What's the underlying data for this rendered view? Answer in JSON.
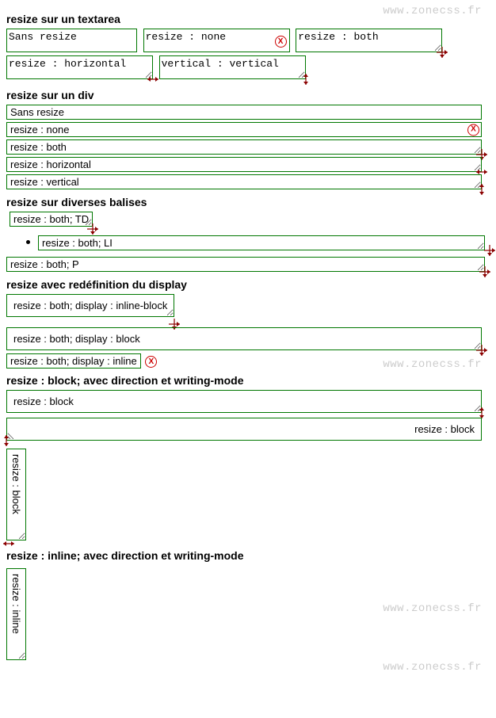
{
  "watermark": "www.zonecss.fr",
  "sections": {
    "textarea": {
      "heading": "resize sur un textarea",
      "items": [
        "Sans resize",
        "resize : none",
        "resize : both",
        "resize : horizontal",
        "vertical : vertical"
      ]
    },
    "div": {
      "heading": "resize sur un div",
      "items": [
        "Sans resize",
        "resize : none",
        "resize : both",
        "resize : horizontal",
        "resize : vertical"
      ]
    },
    "misc": {
      "heading": "resize sur diverses balises",
      "td": "resize : both; TD",
      "li": "resize : both; LI",
      "p": "resize : both; P"
    },
    "display": {
      "heading": "resize avec redéfinition du display",
      "inline_block": "resize : both; display : inline-block",
      "block": "resize : both; display : block",
      "inline": "resize : both; display : inline"
    },
    "block_dir": {
      "heading": "resize : block; avec direction et writing-mode",
      "label": "resize : block"
    },
    "inline_dir": {
      "heading": "resize : inline; avec direction et writing-mode",
      "label": "resize : inline"
    }
  },
  "colors": {
    "border": "#007700",
    "error": "#cc0000",
    "watermark": "#cccccc"
  }
}
